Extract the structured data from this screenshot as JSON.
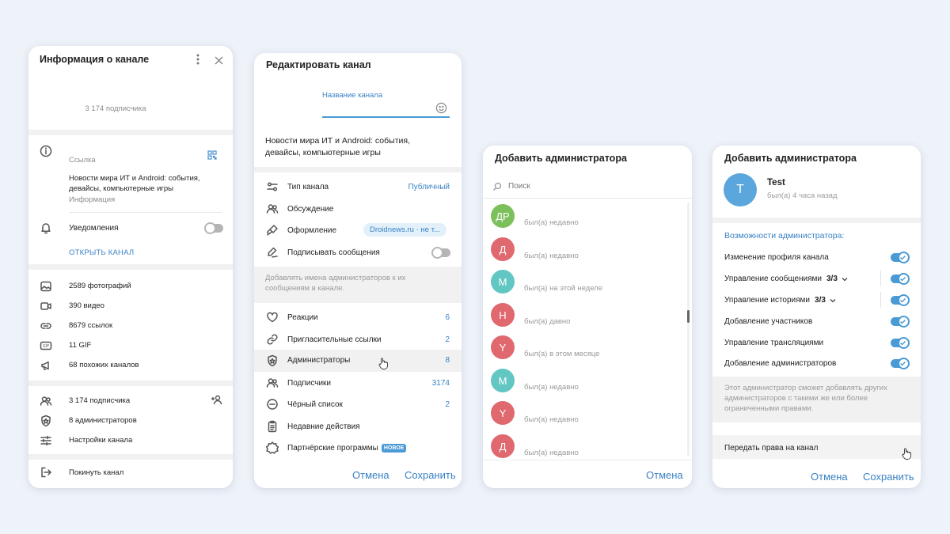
{
  "panel1": {
    "title": "Информация о канале",
    "subscribers_line": "3 174 подписчика",
    "link_label": "Ссылка",
    "description": "Новости мира ИТ и Android: события, девайсы, компьютерные игры",
    "info_label": "Информация",
    "notifications": "Уведомления",
    "open_channel": "ОТКРЫТЬ КАНАЛ",
    "media": [
      {
        "icon": "photo-icon",
        "label": "2589 фотографий"
      },
      {
        "icon": "video-icon",
        "label": "390 видео"
      },
      {
        "icon": "link-icon",
        "label": "8679 ссылок"
      },
      {
        "icon": "gif-icon",
        "label": "11 GIF"
      },
      {
        "icon": "megaphone-icon",
        "label": "68 похожих каналов"
      }
    ],
    "manage": [
      {
        "icon": "users-icon",
        "label": "3 174 подписчика"
      },
      {
        "icon": "shield-icon",
        "label": "8 администраторов"
      },
      {
        "icon": "sliders-icon",
        "label": "Настройки канала"
      }
    ],
    "leave": "Покинуть канал"
  },
  "panel2": {
    "title": "Редактировать канал",
    "name_label": "Название канала",
    "description": "Новости мира ИТ и Android: события, девайсы, компьютерные игры",
    "type_label": "Тип канала",
    "type_value": "Публичный",
    "discussion": "Обсуждение",
    "appearance": "Оформление",
    "appearance_value": "Droidnews.ru · не т...",
    "sign_messages": "Подписывать сообщения",
    "sign_hint": "Добавлять имена администраторов к их сообщениям в канале.",
    "list": [
      {
        "label": "Реакции",
        "value": "6"
      },
      {
        "label": "Пригласительные ссылки",
        "value": "2"
      },
      {
        "label": "Администраторы",
        "value": "8"
      },
      {
        "label": "Подписчики",
        "value": "3174"
      },
      {
        "label": "Чёрный список",
        "value": "2"
      },
      {
        "label": "Недавние действия",
        "value": ""
      },
      {
        "label": "Партнёрские программы",
        "value": ""
      }
    ],
    "new_badge": "НОВОЕ",
    "cancel": "Отмена",
    "save": "Сохранить"
  },
  "panel3": {
    "title": "Добавить администратора",
    "search_placeholder": "Поиск",
    "users": [
      {
        "initials": "ДР",
        "color": "#7cc05c",
        "status": "был(а) недавно"
      },
      {
        "initials": "Д",
        "color": "#e0686f",
        "status": "был(а) недавно"
      },
      {
        "initials": "М",
        "color": "#62c6c2",
        "status": "был(а) на этой неделе"
      },
      {
        "initials": "Н",
        "color": "#e0686f",
        "status": "был(а) давно"
      },
      {
        "initials": "Y",
        "color": "#e0686f",
        "status": "был(а) в этом месяце"
      },
      {
        "initials": "М",
        "color": "#62c6c2",
        "status": "был(а) недавно"
      },
      {
        "initials": "Y",
        "color": "#e0686f",
        "status": "был(а) недавно"
      },
      {
        "initials": "Д",
        "color": "#e0686f",
        "status": "был(а) недавно"
      }
    ],
    "cancel": "Отмена"
  },
  "panel4": {
    "title": "Добавить администратора",
    "user_initial": "T",
    "user_name": "Test",
    "user_status": "был(а) 4 часа назад",
    "rights_title": "Возможности администратора:",
    "rights": [
      {
        "label": "Изменение профиля канала",
        "count": ""
      },
      {
        "label": "Управление сообщениями",
        "count": "3/3"
      },
      {
        "label": "Управление историями",
        "count": "3/3"
      },
      {
        "label": "Добавление участников",
        "count": ""
      },
      {
        "label": "Управление трансляциями",
        "count": ""
      },
      {
        "label": "Добавление администраторов",
        "count": ""
      }
    ],
    "hint": "Этот администратор сможет добавлять других администраторов с такими же или более ограниченными правами.",
    "transfer": "Передать права на канал",
    "cancel": "Отмена",
    "save": "Сохранить"
  }
}
